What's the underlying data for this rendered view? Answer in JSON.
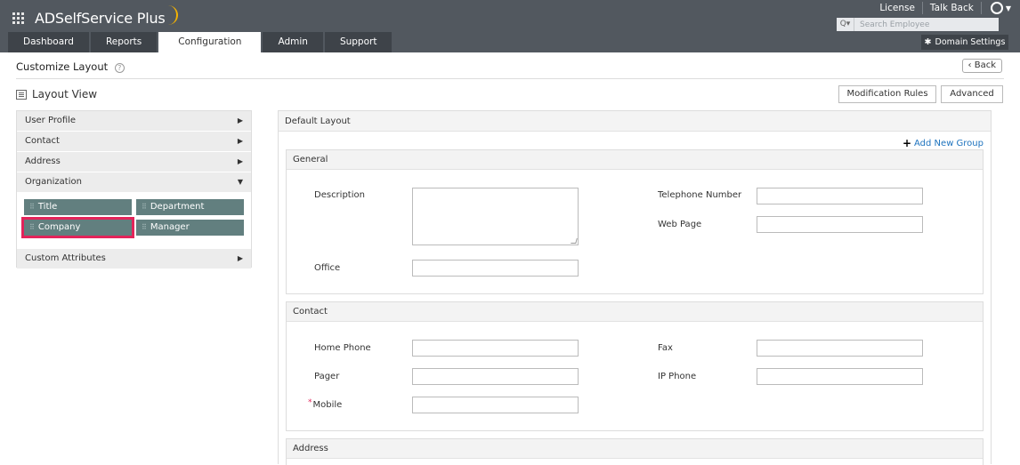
{
  "app": {
    "name": "ADSelfService Plus"
  },
  "header": {
    "links": {
      "license": "License",
      "talkback": "Talk Back"
    },
    "search_placeholder": "Search Employee",
    "domain_settings": "Domain Settings",
    "tabs": [
      {
        "label": "Dashboard"
      },
      {
        "label": "Reports"
      },
      {
        "label": "Configuration"
      },
      {
        "label": "Admin"
      },
      {
        "label": "Support"
      }
    ],
    "active_tab": "Configuration"
  },
  "page": {
    "title": "Customize Layout",
    "back_label": "Back",
    "layout_view_label": "Layout View",
    "modification_rules_label": "Modification Rules",
    "advanced_label": "Advanced"
  },
  "left_panel": {
    "sections": [
      {
        "label": "User Profile"
      },
      {
        "label": "Contact"
      },
      {
        "label": "Address"
      },
      {
        "label": "Organization"
      },
      {
        "label": "Custom Attributes"
      }
    ],
    "organization_fields": [
      {
        "label": "Title"
      },
      {
        "label": "Department"
      },
      {
        "label": "Company",
        "selected": true
      },
      {
        "label": "Manager"
      }
    ]
  },
  "main_panel": {
    "title": "Default Layout",
    "add_group": "Add New Group",
    "groups": {
      "general": {
        "title": "General",
        "fields": {
          "description": "Description",
          "office": "Office",
          "telephone": "Telephone Number",
          "web_page": "Web Page"
        }
      },
      "contact": {
        "title": "Contact",
        "fields": {
          "home_phone": "Home Phone",
          "pager": "Pager",
          "mobile": "Mobile",
          "fax": "Fax",
          "ip_phone": "IP Phone"
        }
      },
      "address": {
        "title": "Address"
      }
    }
  },
  "colors": {
    "header_bg": "#52585f",
    "tab_bg": "#3e4349",
    "chip_bg": "#627f7f",
    "highlight": "#e3245a",
    "link": "#1e73be",
    "logo_arc": "#f5b300"
  }
}
